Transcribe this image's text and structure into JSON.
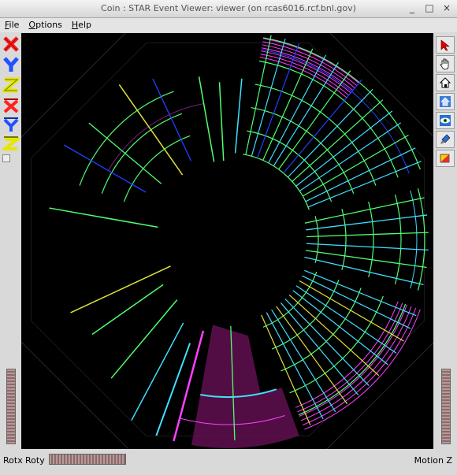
{
  "window": {
    "title": "Coin : STAR Event Viewer: viewer (on rcas6016.rcf.bnl.gov)",
    "controls": {
      "minimize": "_",
      "maximize": "□",
      "close": "×"
    }
  },
  "menu": {
    "items": [
      {
        "first": "F",
        "rest": "ile"
      },
      {
        "first": "O",
        "rest": "ptions"
      },
      {
        "first": "H",
        "rest": "elp"
      }
    ]
  },
  "left_toolbar": {
    "axis_buttons": [
      {
        "letter": "X",
        "icon": "x-axis-icon",
        "color": "#ff2020"
      },
      {
        "letter": "Y",
        "icon": "y-axis-icon",
        "color": "#2050ff"
      },
      {
        "letter": "Z",
        "icon": "z-axis-icon",
        "color": "#e6e600"
      },
      {
        "letter": "X",
        "icon": "x-axis-view-icon",
        "color": "#ff2020"
      },
      {
        "letter": "Y",
        "icon": "y-axis-view-icon",
        "color": "#2050ff"
      },
      {
        "letter": "Z",
        "icon": "z-axis-view-icon",
        "color": "#e6e600"
      }
    ]
  },
  "right_toolbar": {
    "tools": [
      "pick-arrow-icon",
      "pan-hand-icon",
      "home-icon",
      "set-home-icon",
      "view-all-icon",
      "seek-icon",
      "perspective-icon"
    ]
  },
  "bottom": {
    "rotx_label": "Rotx",
    "roty_label": "Roty",
    "motion_label": "Motion Z"
  },
  "colors": {
    "canvas_bg": "#000000",
    "track_green": "#50ff70",
    "track_yellow": "#e0e040",
    "track_cyan": "#40e0ff",
    "track_blue": "#2040ff",
    "track_magenta": "#ff40ff",
    "sector_purple": "#601050"
  }
}
